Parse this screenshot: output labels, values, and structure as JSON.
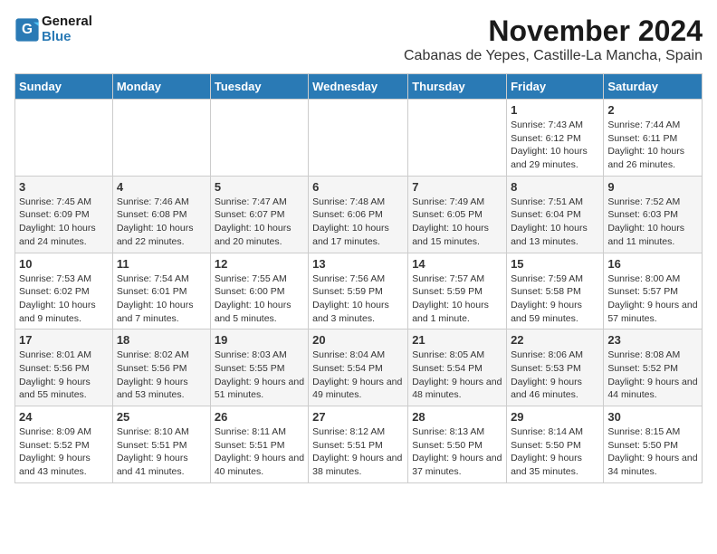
{
  "header": {
    "logo_line1": "General",
    "logo_line2": "Blue",
    "month": "November 2024",
    "location": "Cabanas de Yepes, Castille-La Mancha, Spain"
  },
  "weekdays": [
    "Sunday",
    "Monday",
    "Tuesday",
    "Wednesday",
    "Thursday",
    "Friday",
    "Saturday"
  ],
  "weeks": [
    [
      {
        "day": "",
        "sunrise": "",
        "sunset": "",
        "daylight": ""
      },
      {
        "day": "",
        "sunrise": "",
        "sunset": "",
        "daylight": ""
      },
      {
        "day": "",
        "sunrise": "",
        "sunset": "",
        "daylight": ""
      },
      {
        "day": "",
        "sunrise": "",
        "sunset": "",
        "daylight": ""
      },
      {
        "day": "",
        "sunrise": "",
        "sunset": "",
        "daylight": ""
      },
      {
        "day": "1",
        "sunrise": "Sunrise: 7:43 AM",
        "sunset": "Sunset: 6:12 PM",
        "daylight": "Daylight: 10 hours and 29 minutes."
      },
      {
        "day": "2",
        "sunrise": "Sunrise: 7:44 AM",
        "sunset": "Sunset: 6:11 PM",
        "daylight": "Daylight: 10 hours and 26 minutes."
      }
    ],
    [
      {
        "day": "3",
        "sunrise": "Sunrise: 7:45 AM",
        "sunset": "Sunset: 6:09 PM",
        "daylight": "Daylight: 10 hours and 24 minutes."
      },
      {
        "day": "4",
        "sunrise": "Sunrise: 7:46 AM",
        "sunset": "Sunset: 6:08 PM",
        "daylight": "Daylight: 10 hours and 22 minutes."
      },
      {
        "day": "5",
        "sunrise": "Sunrise: 7:47 AM",
        "sunset": "Sunset: 6:07 PM",
        "daylight": "Daylight: 10 hours and 20 minutes."
      },
      {
        "day": "6",
        "sunrise": "Sunrise: 7:48 AM",
        "sunset": "Sunset: 6:06 PM",
        "daylight": "Daylight: 10 hours and 17 minutes."
      },
      {
        "day": "7",
        "sunrise": "Sunrise: 7:49 AM",
        "sunset": "Sunset: 6:05 PM",
        "daylight": "Daylight: 10 hours and 15 minutes."
      },
      {
        "day": "8",
        "sunrise": "Sunrise: 7:51 AM",
        "sunset": "Sunset: 6:04 PM",
        "daylight": "Daylight: 10 hours and 13 minutes."
      },
      {
        "day": "9",
        "sunrise": "Sunrise: 7:52 AM",
        "sunset": "Sunset: 6:03 PM",
        "daylight": "Daylight: 10 hours and 11 minutes."
      }
    ],
    [
      {
        "day": "10",
        "sunrise": "Sunrise: 7:53 AM",
        "sunset": "Sunset: 6:02 PM",
        "daylight": "Daylight: 10 hours and 9 minutes."
      },
      {
        "day": "11",
        "sunrise": "Sunrise: 7:54 AM",
        "sunset": "Sunset: 6:01 PM",
        "daylight": "Daylight: 10 hours and 7 minutes."
      },
      {
        "day": "12",
        "sunrise": "Sunrise: 7:55 AM",
        "sunset": "Sunset: 6:00 PM",
        "daylight": "Daylight: 10 hours and 5 minutes."
      },
      {
        "day": "13",
        "sunrise": "Sunrise: 7:56 AM",
        "sunset": "Sunset: 5:59 PM",
        "daylight": "Daylight: 10 hours and 3 minutes."
      },
      {
        "day": "14",
        "sunrise": "Sunrise: 7:57 AM",
        "sunset": "Sunset: 5:59 PM",
        "daylight": "Daylight: 10 hours and 1 minute."
      },
      {
        "day": "15",
        "sunrise": "Sunrise: 7:59 AM",
        "sunset": "Sunset: 5:58 PM",
        "daylight": "Daylight: 9 hours and 59 minutes."
      },
      {
        "day": "16",
        "sunrise": "Sunrise: 8:00 AM",
        "sunset": "Sunset: 5:57 PM",
        "daylight": "Daylight: 9 hours and 57 minutes."
      }
    ],
    [
      {
        "day": "17",
        "sunrise": "Sunrise: 8:01 AM",
        "sunset": "Sunset: 5:56 PM",
        "daylight": "Daylight: 9 hours and 55 minutes."
      },
      {
        "day": "18",
        "sunrise": "Sunrise: 8:02 AM",
        "sunset": "Sunset: 5:56 PM",
        "daylight": "Daylight: 9 hours and 53 minutes."
      },
      {
        "day": "19",
        "sunrise": "Sunrise: 8:03 AM",
        "sunset": "Sunset: 5:55 PM",
        "daylight": "Daylight: 9 hours and 51 minutes."
      },
      {
        "day": "20",
        "sunrise": "Sunrise: 8:04 AM",
        "sunset": "Sunset: 5:54 PM",
        "daylight": "Daylight: 9 hours and 49 minutes."
      },
      {
        "day": "21",
        "sunrise": "Sunrise: 8:05 AM",
        "sunset": "Sunset: 5:54 PM",
        "daylight": "Daylight: 9 hours and 48 minutes."
      },
      {
        "day": "22",
        "sunrise": "Sunrise: 8:06 AM",
        "sunset": "Sunset: 5:53 PM",
        "daylight": "Daylight: 9 hours and 46 minutes."
      },
      {
        "day": "23",
        "sunrise": "Sunrise: 8:08 AM",
        "sunset": "Sunset: 5:52 PM",
        "daylight": "Daylight: 9 hours and 44 minutes."
      }
    ],
    [
      {
        "day": "24",
        "sunrise": "Sunrise: 8:09 AM",
        "sunset": "Sunset: 5:52 PM",
        "daylight": "Daylight: 9 hours and 43 minutes."
      },
      {
        "day": "25",
        "sunrise": "Sunrise: 8:10 AM",
        "sunset": "Sunset: 5:51 PM",
        "daylight": "Daylight: 9 hours and 41 minutes."
      },
      {
        "day": "26",
        "sunrise": "Sunrise: 8:11 AM",
        "sunset": "Sunset: 5:51 PM",
        "daylight": "Daylight: 9 hours and 40 minutes."
      },
      {
        "day": "27",
        "sunrise": "Sunrise: 8:12 AM",
        "sunset": "Sunset: 5:51 PM",
        "daylight": "Daylight: 9 hours and 38 minutes."
      },
      {
        "day": "28",
        "sunrise": "Sunrise: 8:13 AM",
        "sunset": "Sunset: 5:50 PM",
        "daylight": "Daylight: 9 hours and 37 minutes."
      },
      {
        "day": "29",
        "sunrise": "Sunrise: 8:14 AM",
        "sunset": "Sunset: 5:50 PM",
        "daylight": "Daylight: 9 hours and 35 minutes."
      },
      {
        "day": "30",
        "sunrise": "Sunrise: 8:15 AM",
        "sunset": "Sunset: 5:50 PM",
        "daylight": "Daylight: 9 hours and 34 minutes."
      }
    ]
  ]
}
